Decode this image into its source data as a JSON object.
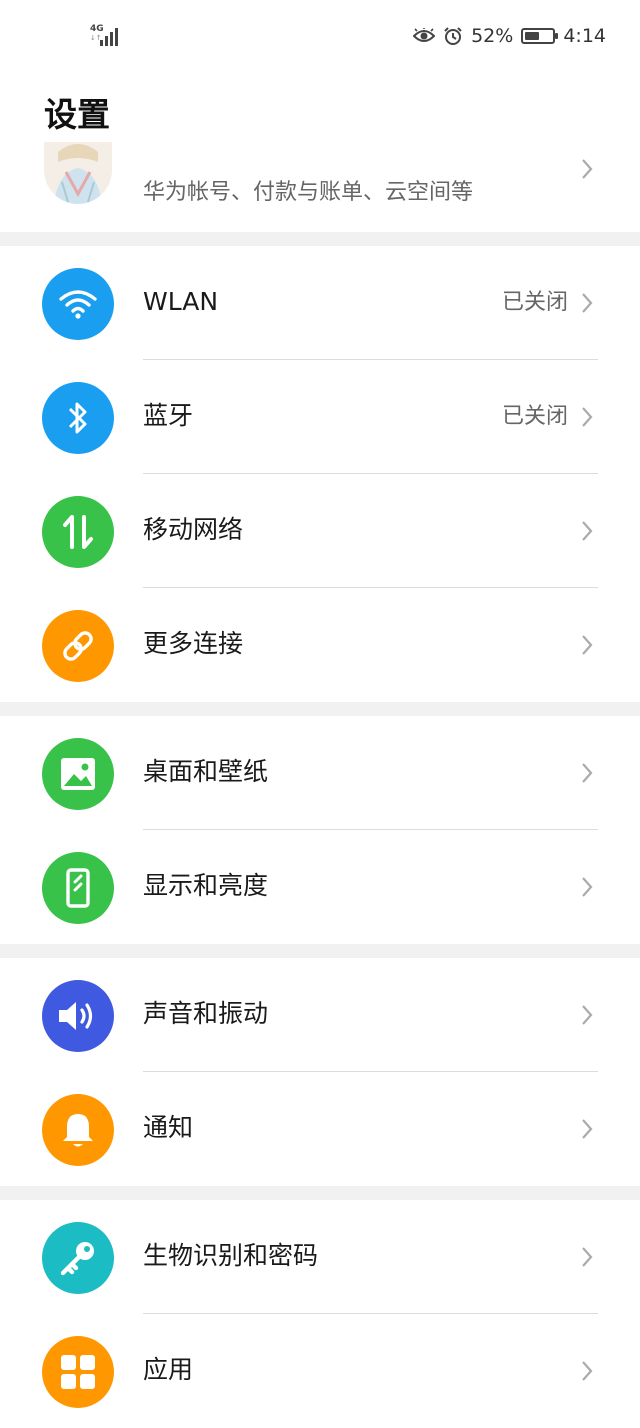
{
  "status_bar": {
    "network": "4G",
    "battery_text": "52%",
    "battery_level": 0.52,
    "time": "4:14",
    "icons": [
      "eye-comfort-icon",
      "alarm-icon",
      "battery-icon"
    ]
  },
  "page": {
    "title": "设置"
  },
  "account": {
    "name": "",
    "subtitle": "华为帐号、付款与账单、云空间等"
  },
  "groups": [
    {
      "items": [
        {
          "label": "WLAN",
          "status": "已关闭",
          "icon": "wifi-icon",
          "color": "#1a9ff0"
        },
        {
          "label": "蓝牙",
          "status": "已关闭",
          "icon": "bluetooth-icon",
          "color": "#1a9ff0"
        },
        {
          "label": "移动网络",
          "status": "",
          "icon": "mobile-data-icon",
          "color": "#39c24a"
        },
        {
          "label": "更多连接",
          "status": "",
          "icon": "link-icon",
          "color": "#ff9800"
        }
      ]
    },
    {
      "items": [
        {
          "label": "桌面和壁纸",
          "status": "",
          "icon": "wallpaper-icon",
          "color": "#39c24a"
        },
        {
          "label": "显示和亮度",
          "status": "",
          "icon": "display-icon",
          "color": "#39c24a"
        }
      ]
    },
    {
      "items": [
        {
          "label": "声音和振动",
          "status": "",
          "icon": "volume-icon",
          "color": "#3f5ae0"
        },
        {
          "label": "通知",
          "status": "",
          "icon": "bell-icon",
          "color": "#ff9800"
        }
      ]
    },
    {
      "items": [
        {
          "label": "生物识别和密码",
          "status": "",
          "icon": "key-icon",
          "color": "#1cbcc4"
        },
        {
          "label": "应用",
          "status": "",
          "icon": "apps-icon",
          "color": "#ff9800"
        }
      ]
    }
  ]
}
